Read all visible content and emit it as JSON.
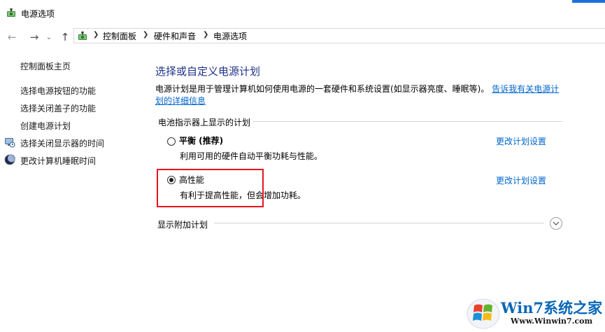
{
  "window": {
    "title": "电源选项",
    "accent_color": "#1f6fd8"
  },
  "nav": {
    "back_icon": "arrow-left-icon",
    "forward_icon": "arrow-right-icon",
    "recent_icon": "chevron-down-icon",
    "up_icon": "arrow-up-icon"
  },
  "breadcrumb": [
    "控制面板",
    "硬件和声音",
    "电源选项"
  ],
  "sidebar": {
    "home": "控制面板主页",
    "links": [
      {
        "label": "选择电源按钮的功能",
        "icon": null
      },
      {
        "label": "选择关闭盖子的功能",
        "icon": null
      },
      {
        "label": "创建电源计划",
        "icon": null
      },
      {
        "label": "选择关闭显示器的时间",
        "icon": "monitor-clock-icon"
      },
      {
        "label": "更改计算机睡眠时间",
        "icon": "moon-icon"
      }
    ]
  },
  "main": {
    "heading": "选择或自定义电源计划",
    "description": "电源计划是用于管理计算机如何使用电源的一套硬件和系统设置(如显示器亮度、睡眠等)。",
    "description_link": "告诉我有关电源计划的详细信息",
    "group_label": "电池指示器上显示的计划",
    "plans": [
      {
        "name": "平衡 (推荐)",
        "desc": "利用可用的硬件自动平衡功耗与性能。",
        "selected": false,
        "change_link": "更改计划设置"
      },
      {
        "name": "高性能",
        "desc": "有利于提高性能，但会增加功耗。",
        "selected": true,
        "change_link": "更改计划设置"
      }
    ],
    "show_more": "显示附加计划",
    "highlight_color": "#e8141c"
  },
  "watermark": {
    "title": "Win7系统之家",
    "url": "Www.Winwin7.com"
  }
}
